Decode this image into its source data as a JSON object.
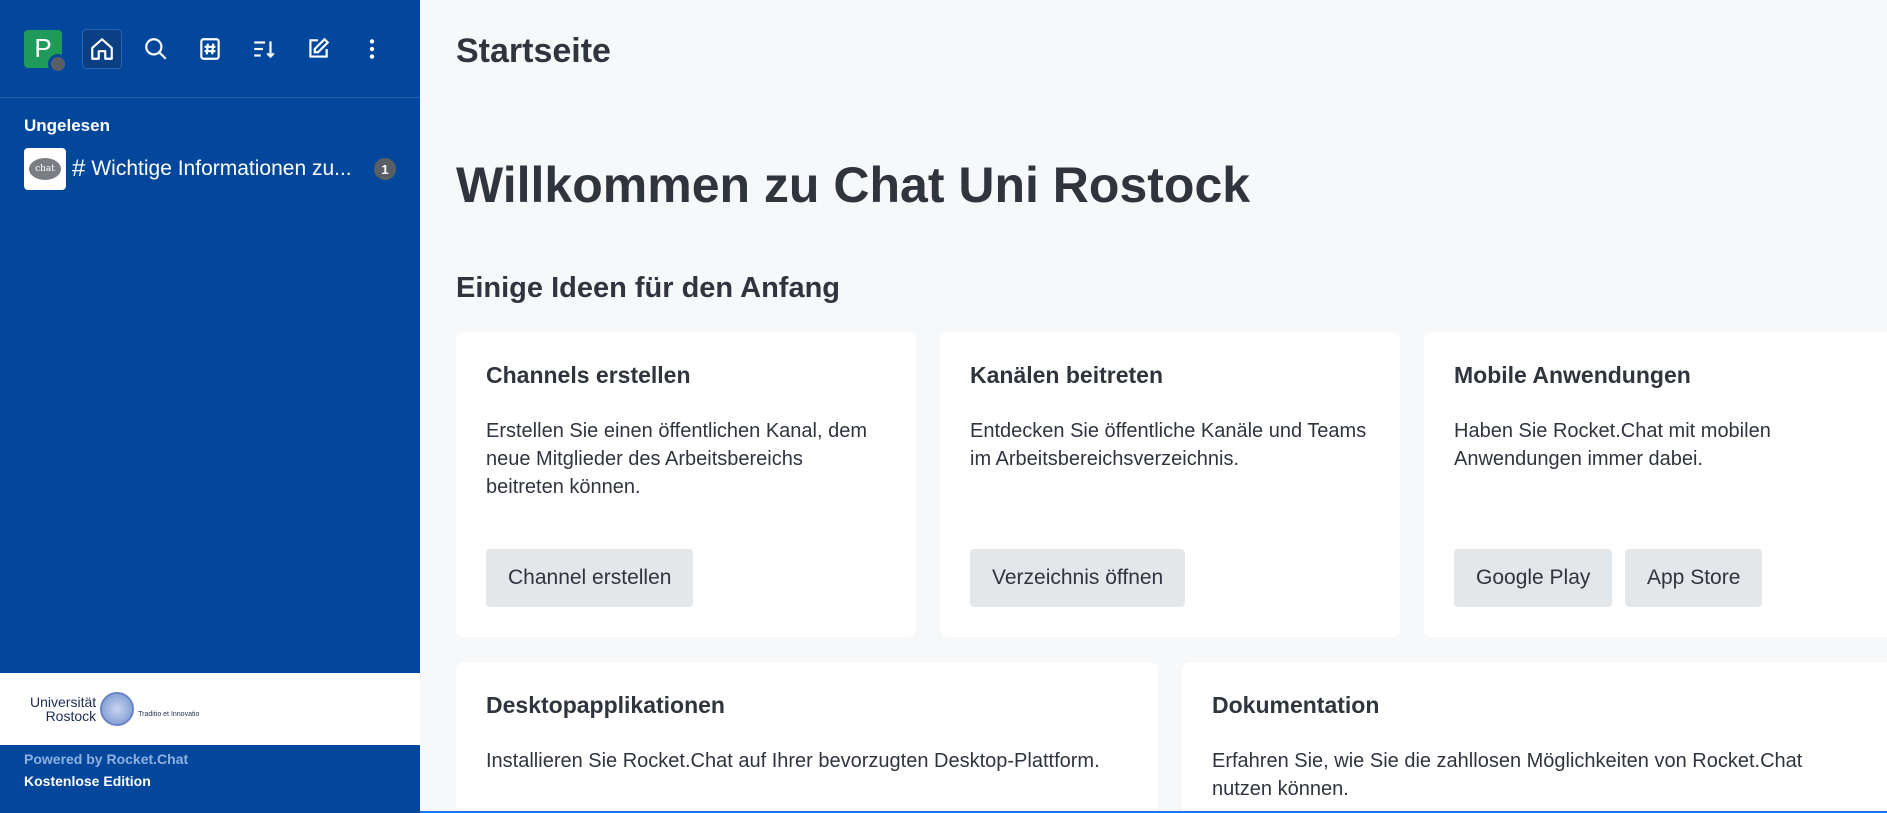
{
  "colors": {
    "sidebar_bg": "#02479b",
    "main_bg": "#f7f8fa",
    "avatar_bg": "#1f9a5a"
  },
  "user": {
    "initial": "P"
  },
  "toolbar": {
    "icons": [
      "home-icon",
      "search-icon",
      "directory-icon",
      "sort-icon",
      "create-new-icon",
      "kebab-menu-icon"
    ]
  },
  "sidebar": {
    "section_label": "Ungelesen",
    "rooms": [
      {
        "avatar_text": "chat",
        "prefix": "#",
        "name": "Wichtige Informationen zu...",
        "unread": "1"
      }
    ]
  },
  "footer": {
    "logo_line1": "Universität",
    "logo_line2": "Rostock",
    "logo_motto": "Traditio et Innovatio",
    "powered": "Powered by Rocket.Chat",
    "edition": "Kostenlose Edition"
  },
  "main": {
    "header_title": "Startseite",
    "welcome": "Willkommen zu Chat Uni Rostock",
    "ideas_heading": "Einige Ideen für den Anfang",
    "cards": [
      {
        "title": "Channels erstellen",
        "text": "Erstellen Sie einen öffentlichen Kanal, dem neue Mitglieder des Arbeitsbereichs beitreten können.",
        "buttons": [
          "Channel erstellen"
        ]
      },
      {
        "title": "Kanälen beitreten",
        "text": "Entdecken Sie öffentliche Kanäle und Teams im Arbeitsbereichsverzeichnis.",
        "buttons": [
          "Verzeichnis öffnen"
        ]
      },
      {
        "title": "Mobile Anwendungen",
        "text": "Haben Sie Rocket.Chat mit mobilen Anwendungen immer dabei.",
        "buttons": [
          "Google Play",
          "App Store"
        ]
      },
      {
        "title": "Desktopapplikationen",
        "text": "Installieren Sie Rocket.Chat auf Ihrer bevorzugten Desktop-Plattform.",
        "buttons": []
      },
      {
        "title": "Dokumentation",
        "text": "Erfahren Sie, wie Sie die zahllosen Möglichkeiten von Rocket.Chat nutzen können.",
        "buttons": []
      }
    ]
  }
}
